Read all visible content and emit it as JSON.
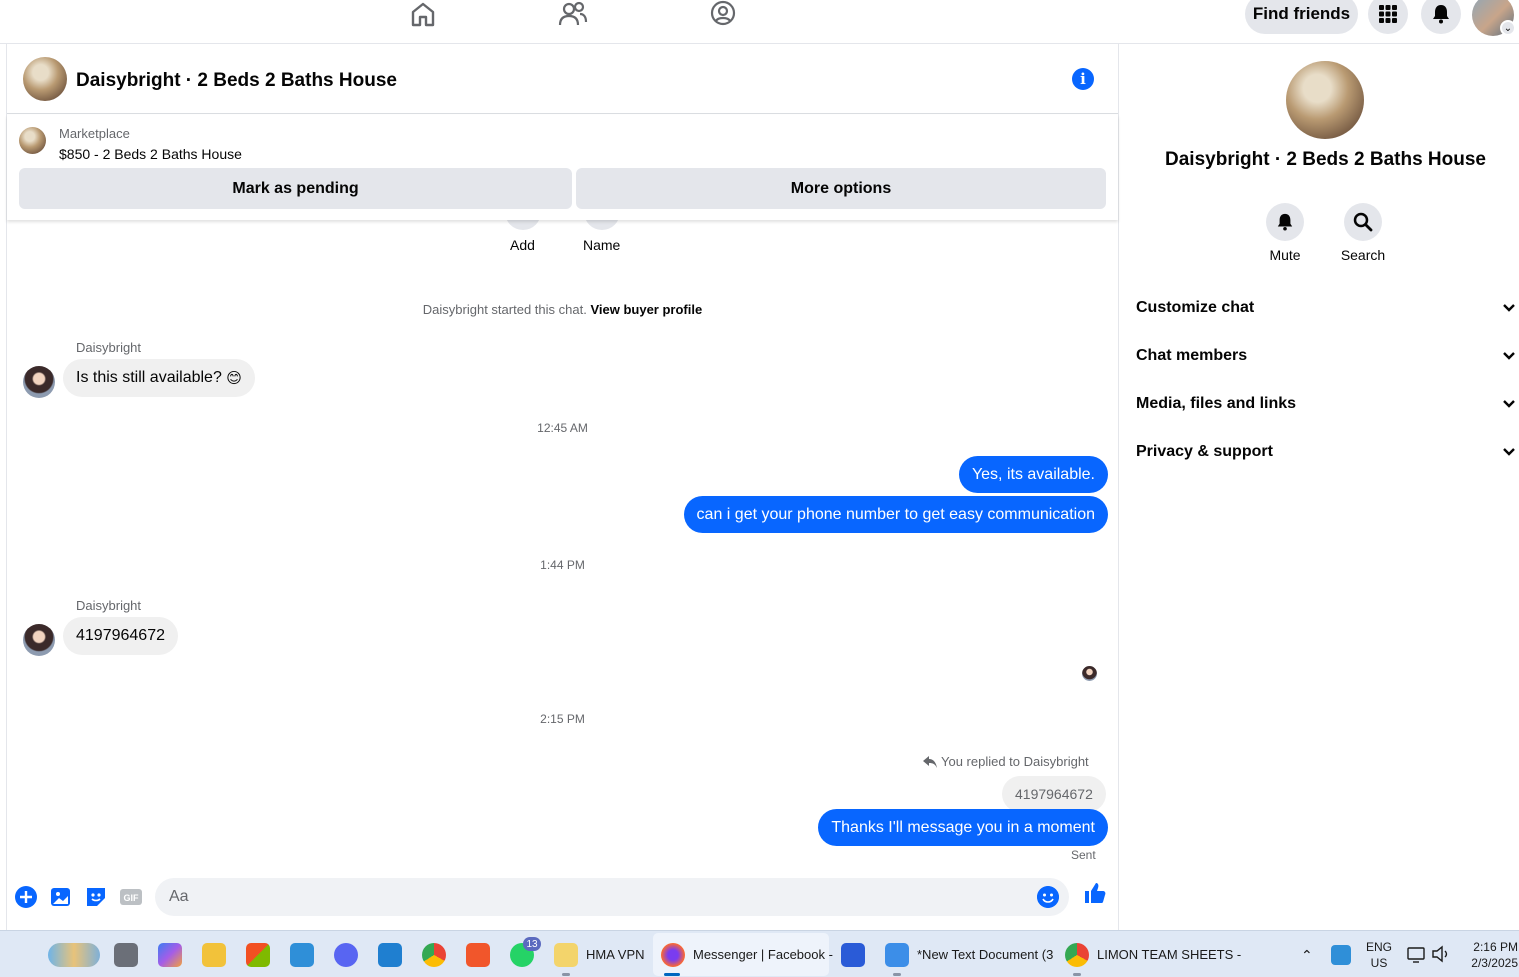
{
  "topnav": {
    "find_friends_label": "Find friends"
  },
  "chat": {
    "header_title": "Daisybright · 2 Beds 2 Baths House",
    "marketplace_label": "Marketplace",
    "listing_line": "$850 - 2 Beds 2 Baths House",
    "mark_pending_label": "Mark as pending",
    "more_options_label": "More options",
    "add_label": "Add",
    "name_label": "Name",
    "started_text": "Daisybright started this chat.",
    "view_buyer_profile": "View buyer profile",
    "messages": [
      {
        "sender": "Daisybright",
        "text": "Is this still available?",
        "emoji": "😊"
      },
      {
        "timestamp": "12:45 AM"
      },
      {
        "text": "Yes, its available."
      },
      {
        "text": "can i get your phone number to get easy communication"
      },
      {
        "timestamp": "1:44 PM"
      },
      {
        "sender": "Daisybright",
        "text": "4197964672"
      },
      {
        "timestamp": "2:15 PM"
      },
      {
        "replied_to": "You replied to Daisybright",
        "quoted": "4197964672"
      },
      {
        "text": "Thanks I'll message you in a moment",
        "status": "Sent"
      }
    ],
    "composer_placeholder": "Aa"
  },
  "right_panel": {
    "title": "Daisybright · 2 Beds 2 Baths House",
    "mute_label": "Mute",
    "search_label": "Search",
    "sections": [
      "Customize chat",
      "Chat members",
      "Media, files and links",
      "Privacy & support"
    ]
  },
  "taskbar": {
    "hma_label": "HMA VPN",
    "messenger_label": "Messenger | Facebook -",
    "notepad_label": "*New Text Document (3",
    "chrome_label": "LIMON TEAM SHEETS -",
    "whatsapp_badge": "13",
    "lang_top": "ENG",
    "lang_bottom": "US",
    "time": "2:16 PM",
    "date": "2/3/2025"
  },
  "colors": {
    "accent": "#0866ff",
    "bubble_in": "#f0f0f0",
    "button_gray": "#e4e6eb"
  }
}
